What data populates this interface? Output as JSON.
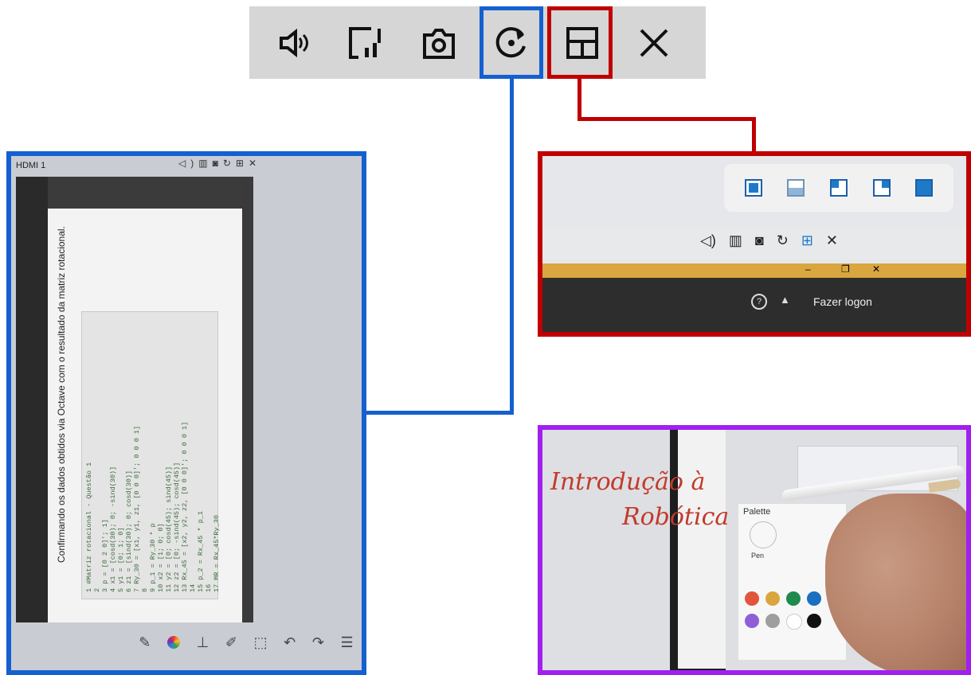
{
  "toolbar": {
    "icons": [
      "volume-icon",
      "screen-mirror-icon",
      "camera-icon",
      "rotate-icon",
      "layout-icon",
      "close-icon"
    ]
  },
  "left_panel": {
    "source_label": "HDMI 1",
    "caption": "Confirmando os dados obtidos via Octave com o resultado da matriz rotacional.",
    "code_lines": [
      "1  #Matriz rotacional - Questão 1",
      "2",
      "3  p = [0 2 0]'; 1]",
      "4  x1 = [cosd(30); 0; -sind(30)]",
      "5  y1 = [0; 1; 0]",
      "6  z1 = [sind(30); 0; cosd(30)]",
      "7  Ry_30 = [x1, y1, z1, [0 0 0]'; 0 0 0 1]",
      "8",
      "9  p_1 = Ry_30 * p",
      "10 x2 = [1; 0; 0]",
      "11 y2 = [0; cosd(45); sind(45)]",
      "12 z2 = [0; -sind(45); cosd(45)]",
      "13 Rx_45 = [x2, y2, z2, [0 0 0]'; 0 0 0 1]",
      "14",
      "15 p_2 = Rx_45 * p_1",
      "16",
      "17 MR = Rx_45*Ry_30"
    ]
  },
  "right_top": {
    "window_btns": [
      "–",
      "❐",
      "✕"
    ],
    "login_text": "Fazer logon",
    "help_glyph": "?",
    "bell_glyph": "▲"
  },
  "right_bottom": {
    "handwriting_line1": "Introdução à",
    "handwriting_line2": "Robótica",
    "palette_title": "Palette",
    "pen_label": "Pen",
    "swatches": [
      "#e2553d",
      "#d9a63e",
      "#1f8a4c",
      "#1a6fc0",
      "#f0f0f0",
      "#8e5fd6",
      "#9e9e9e",
      "#ffffff",
      "#111111",
      "#4aa0e0",
      "#2db0a0",
      "#e53935"
    ]
  }
}
